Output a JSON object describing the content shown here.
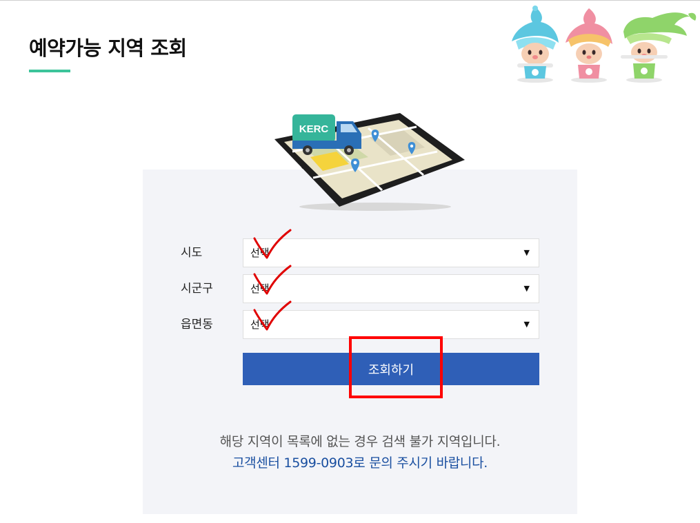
{
  "header": {
    "title": "예약가능 지역 조회"
  },
  "illustration": {
    "truck_label": "KERC"
  },
  "form": {
    "fields": [
      {
        "label": "시도",
        "value": "선택"
      },
      {
        "label": "시군구",
        "value": "선택"
      },
      {
        "label": "읍면동",
        "value": "선택"
      }
    ],
    "caret": "▼",
    "submit_label": "조회하기"
  },
  "notice": {
    "line1": "해당 지역이 목록에 없는 경우 검색 불가 지역입니다.",
    "line2": "고객센터 1599-0903로 문의 주시기 바랍니다."
  },
  "colors": {
    "accent_green": "#3cc49a",
    "button_blue": "#2f5fb7",
    "notice_blue": "#1a4fa0",
    "panel_bg": "#f3f4f8",
    "annotation_red": "#ff0000"
  }
}
